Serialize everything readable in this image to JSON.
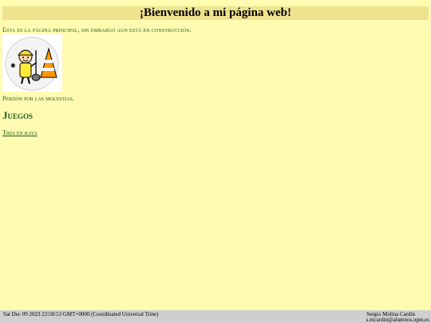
{
  "header": {
    "title": "¡Bienvenido a mi página web!"
  },
  "main": {
    "intro_text": "Esta es la página principal, sin embargo aun está en construcción.",
    "image_icon": "under-construction-worker-icon",
    "apology_text": "Perdón por las molestias.",
    "games_heading": "Juegos",
    "games_links": [
      "Tres en raya"
    ]
  },
  "footer": {
    "datetime": "Sat Dec 09 2023 23:58:53 GMT+0000 (Coordinated Universal Time)",
    "author": "Sergio Molina Cardín",
    "email": "s.mcardin@alumnos.upm.es"
  },
  "colors": {
    "background": "#fffbb0",
    "banner": "#efe38f",
    "text": "#1b5e20",
    "footer": "#cfcfcf"
  }
}
